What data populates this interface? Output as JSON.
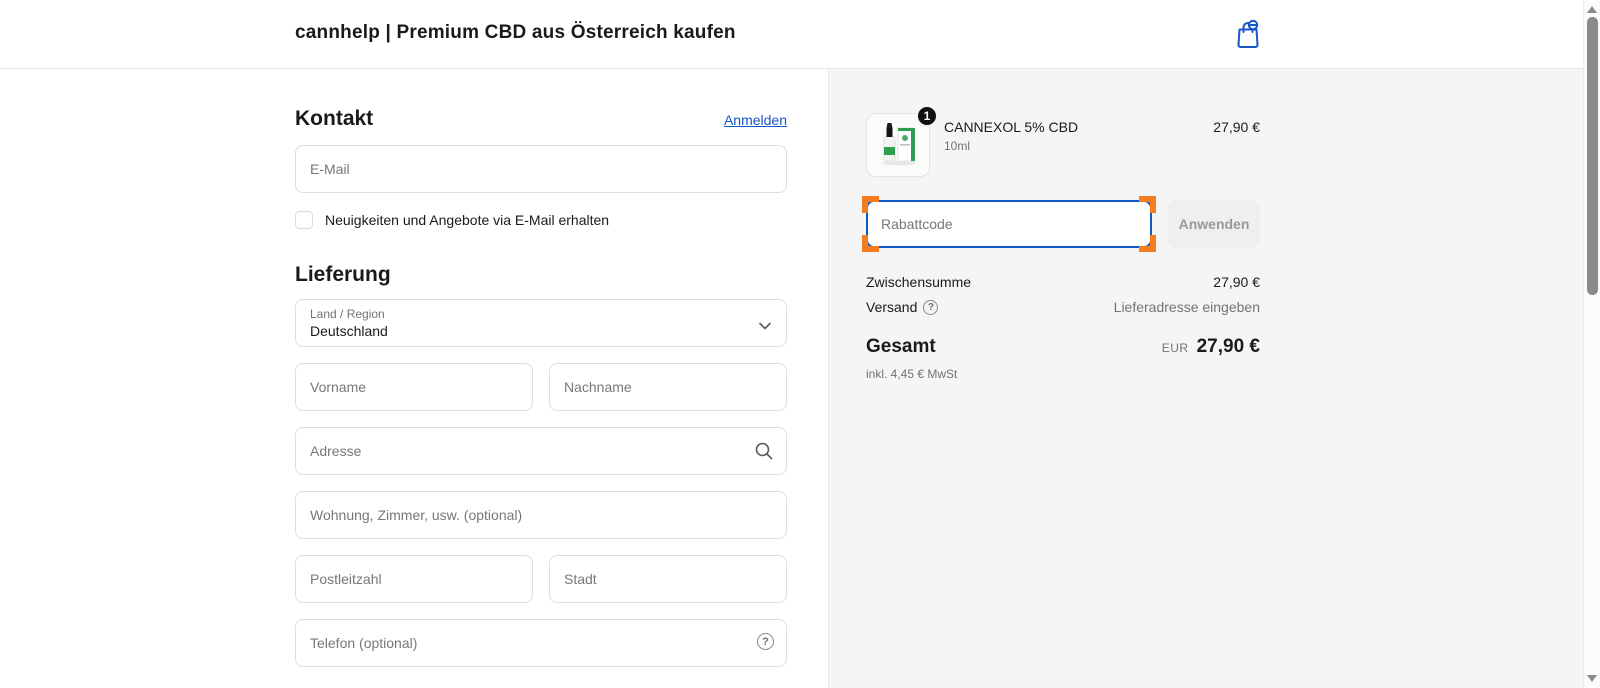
{
  "header": {
    "title": "cannhelp | Premium CBD aus Österreich kaufen"
  },
  "contact": {
    "heading": "Kontakt",
    "login_label": "Anmelden",
    "email_placeholder": "E-Mail",
    "newsletter_label": "Neuigkeiten und Angebote via E-Mail erhalten"
  },
  "delivery": {
    "heading": "Lieferung",
    "country_label": "Land / Region",
    "country_value": "Deutschland",
    "first_name_placeholder": "Vorname",
    "last_name_placeholder": "Nachname",
    "address_placeholder": "Adresse",
    "apartment_placeholder": "Wohnung, Zimmer, usw. (optional)",
    "zip_placeholder": "Postleitzahl",
    "city_placeholder": "Stadt",
    "phone_placeholder": "Telefon (optional)",
    "help_glyph": "?"
  },
  "summary": {
    "item": {
      "name": "CANNEXOL 5% CBD",
      "variant": "10ml",
      "quantity": "1",
      "price": "27,90 €"
    },
    "discount_placeholder": "Rabattcode",
    "apply_label": "Anwenden",
    "subtotal_label": "Zwischensumme",
    "subtotal_value": "27,90 €",
    "shipping_label": "Versand",
    "shipping_help_glyph": "?",
    "shipping_value": "Lieferadresse eingeben",
    "total_label": "Gesamt",
    "currency_code": "EUR",
    "total_value": "27,90 €",
    "tax_note": "inkl. 4,45 € MwSt"
  },
  "colors": {
    "accent-blue": "#1657c9",
    "focus-blue": "#0f57c4",
    "highlight-orange": "#f57c1f",
    "panel-bg": "#f5f5f5",
    "border-gray": "#dedede",
    "muted": "#737373"
  }
}
